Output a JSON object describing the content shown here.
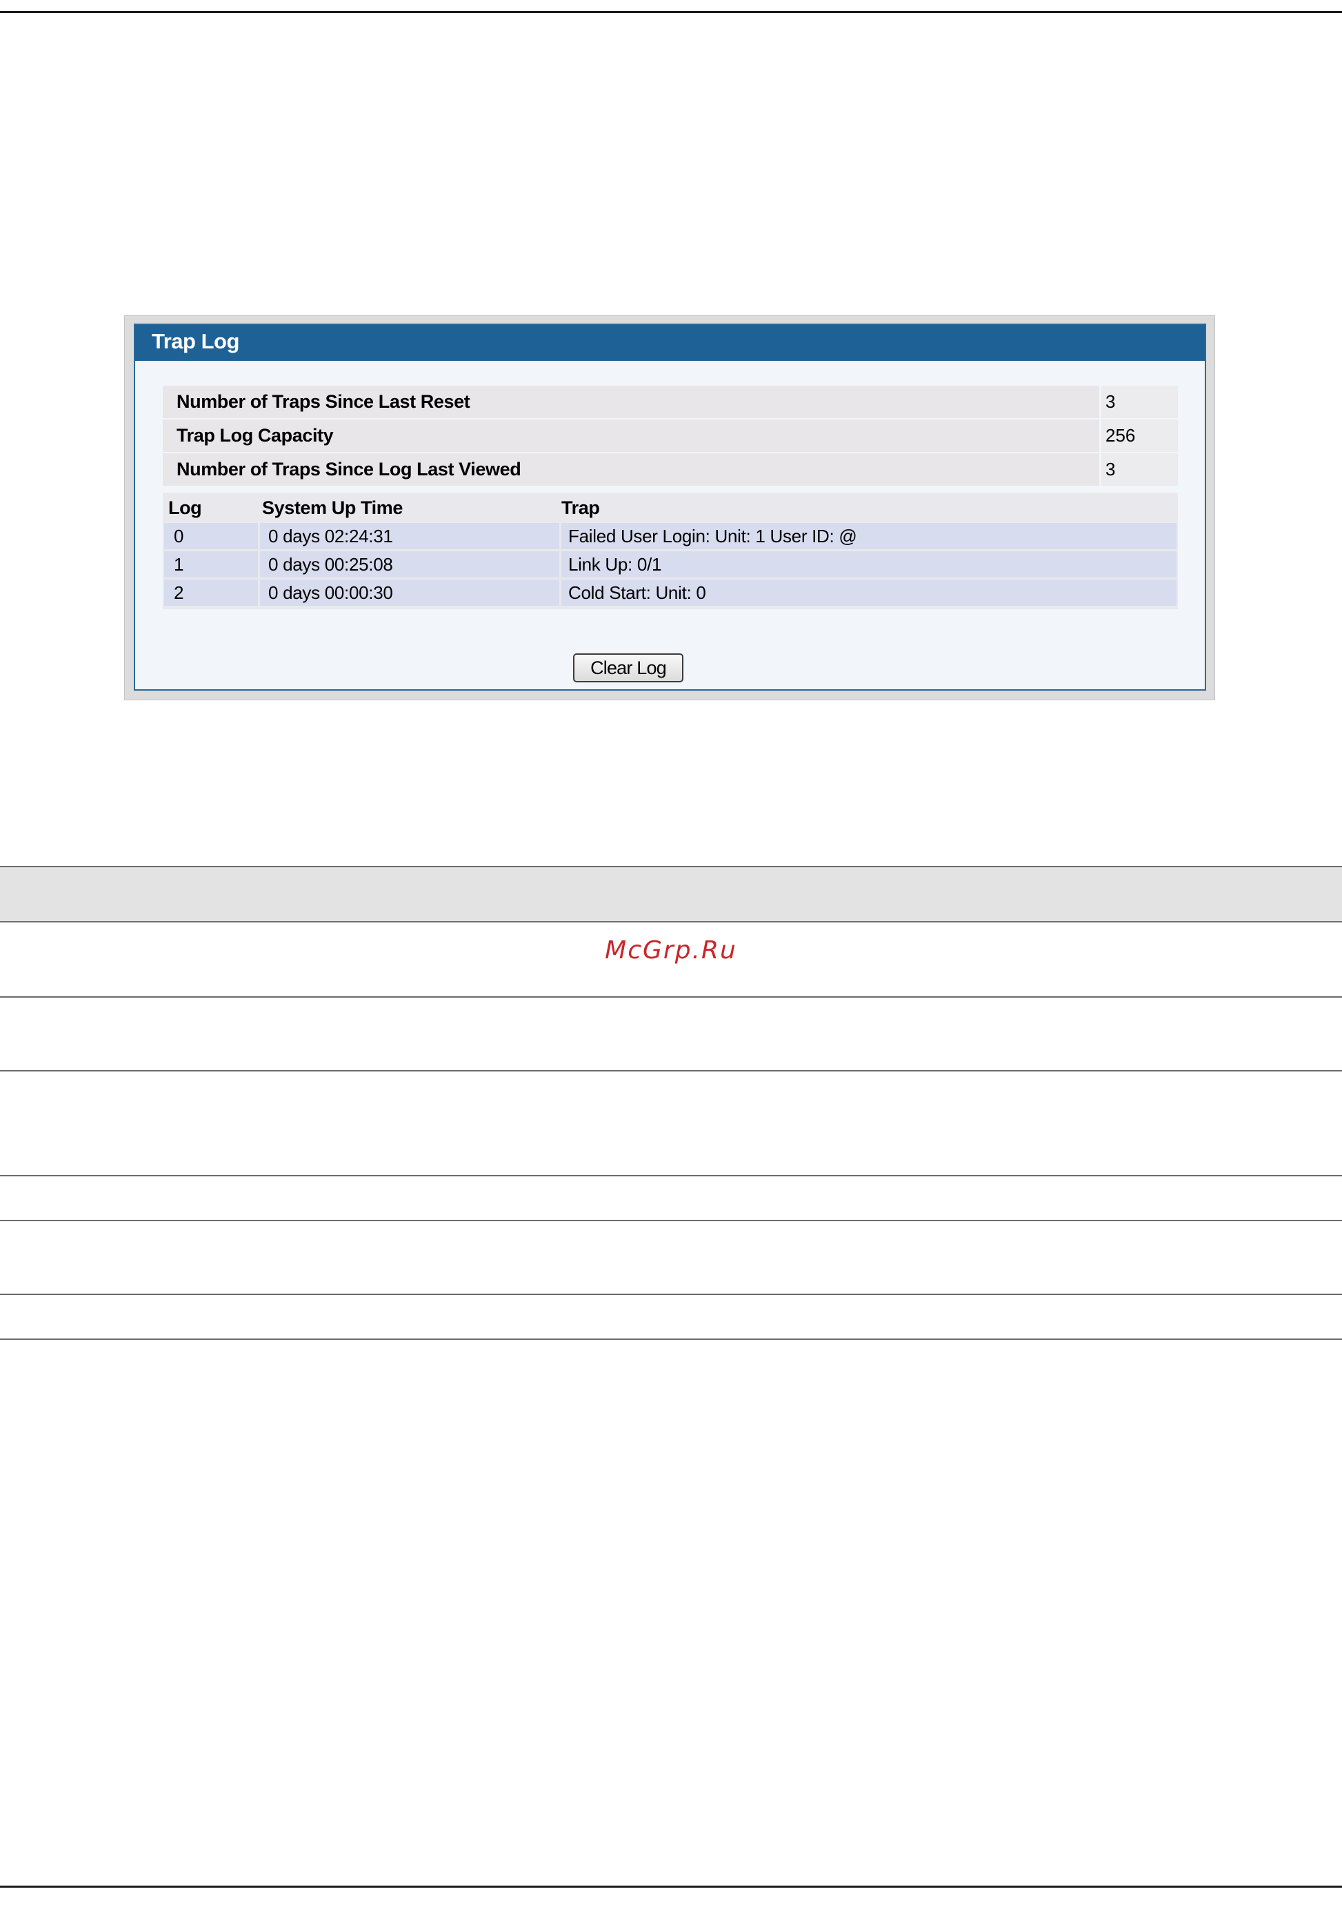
{
  "panel": {
    "title": "Trap Log"
  },
  "summary": [
    {
      "label": "Number of Traps Since Last Reset",
      "value": "3"
    },
    {
      "label": "Trap Log Capacity",
      "value": "256"
    },
    {
      "label": "Number of Traps Since Log Last Viewed",
      "value": "3"
    }
  ],
  "log_table": {
    "headers": {
      "log": "Log",
      "time": "System Up Time",
      "trap": "Trap"
    },
    "rows": [
      {
        "log": "0",
        "time": "0 days 02:24:31",
        "trap": "Failed User Login: Unit: 1 User ID: @"
      },
      {
        "log": "1",
        "time": "0 days 00:25:08",
        "trap": "Link Up: 0/1"
      },
      {
        "log": "2",
        "time": "0 days 00:00:30",
        "trap": "Cold Start: Unit: 0"
      }
    ]
  },
  "buttons": {
    "clear_log": "Clear Log"
  },
  "watermark": "McGrp.Ru",
  "colors": {
    "panel_header": "#1e6196",
    "row_fill": "#d7dcee",
    "watermark": "#c8262b"
  }
}
